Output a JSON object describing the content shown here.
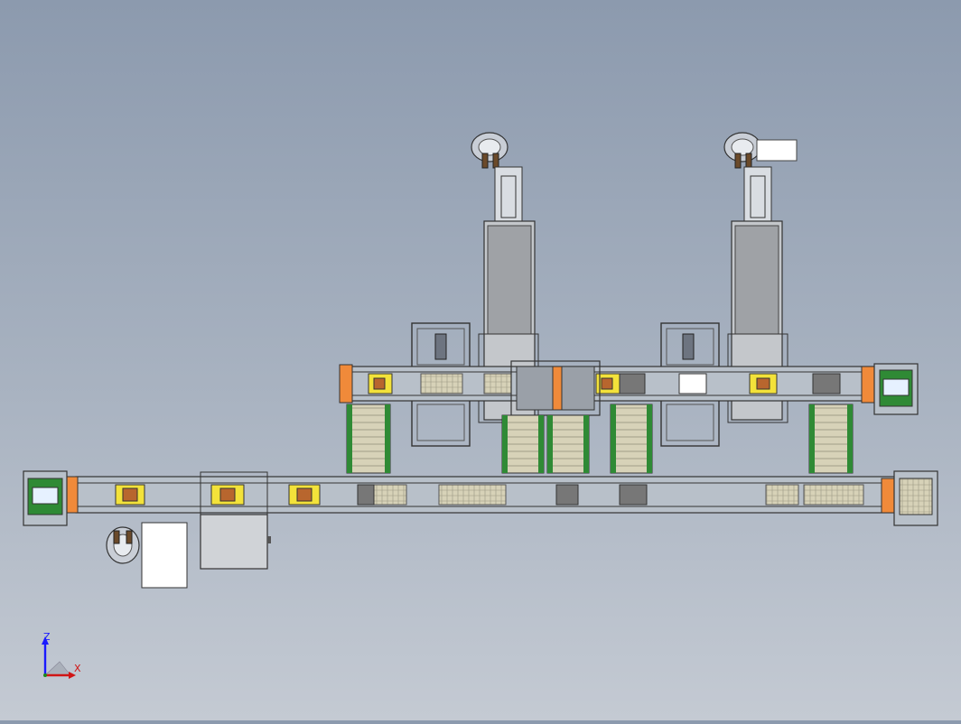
{
  "viewport": {
    "background_top": "#8c9aae",
    "background_bottom": "#c4cad3"
  },
  "triad": {
    "z_label": "Z",
    "x_label": "X",
    "z_color": "#1a1aff",
    "x_color": "#d01515",
    "y_color": "#1a8a1a"
  },
  "colors": {
    "frame": "#5d6876",
    "frame_light": "#b8c0c9",
    "belt_green": "#2f8a35",
    "fixture_yellow": "#f3e23a",
    "fixture_brown": "#b8662e",
    "motor_orange": "#f08a3a",
    "column_grey": "#9fa2a6",
    "part_beige": "#d7d2b8",
    "box_white": "#ffffff"
  }
}
